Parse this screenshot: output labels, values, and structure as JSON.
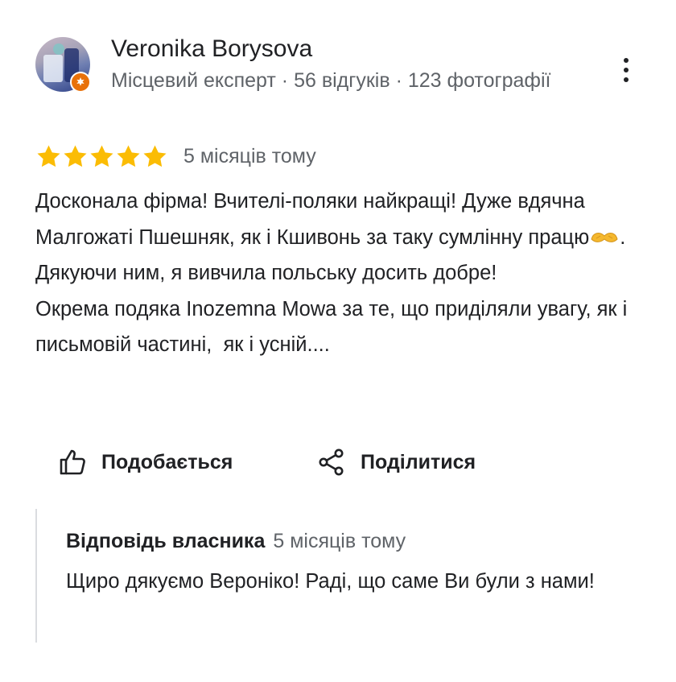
{
  "reviewer": {
    "name": "Veronika Borysova",
    "meta": "Місцевий експерт · 56 відгуків · 123 фотографії",
    "avatar_icon": "profile-photo",
    "badge_icon": "local-guide-badge-icon",
    "badge_color": "#e8710a"
  },
  "more_icon": "more-vertical-icon",
  "rating": {
    "stars": 5,
    "max": 5,
    "star_color": "#fbbc04"
  },
  "review": {
    "time": "5 місяців тому",
    "text_part1": "Досконала фірма! Вчителі-поляки найкращі! Дуже вдячна Малгожаті Пшешняк, як і Кшивонь за таку сумлінну працю",
    "emoji_icon": "heart-hands-emoji",
    "text_part2": ". Дякуючи ним, я вивчила польську досить добре!",
    "text_para2": "Окрема подяка Inozemna Mowa за те, що приділяли увагу, як і письмовій частині,  як і усній...."
  },
  "actions": {
    "like_label": "Подобається",
    "like_icon": "thumbs-up-icon",
    "share_label": "Поділитися",
    "share_icon": "share-icon"
  },
  "owner_response": {
    "label": "Відповідь власника",
    "time": "5 місяців тому",
    "text": "Щиро дякуємо Вероніко! Раді, що саме Ви були з нами!"
  }
}
